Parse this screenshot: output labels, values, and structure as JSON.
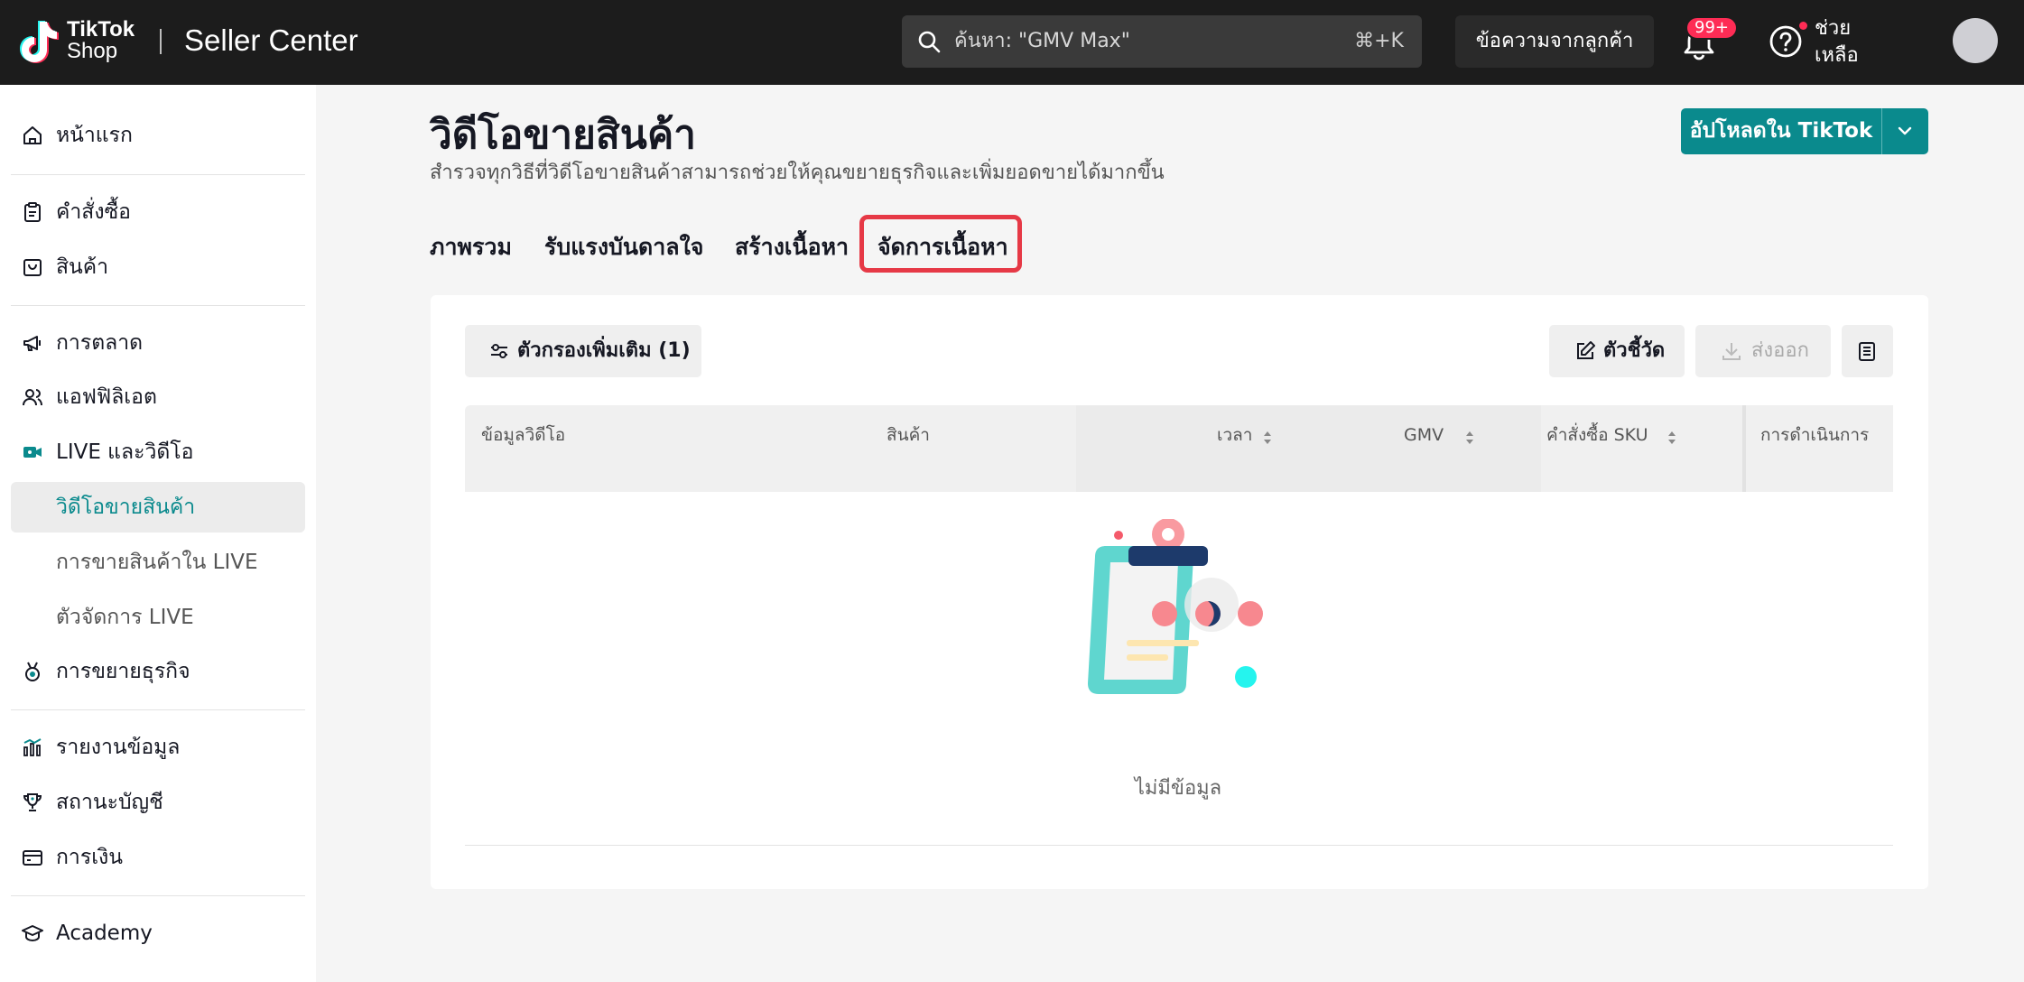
{
  "header": {
    "logo_tiktok": "TikTok",
    "logo_shop": "Shop",
    "title": "Seller Center",
    "search_placeholder": "ค้นหา: \"GMV Max\"",
    "search_shortcut": "⌘+K",
    "messages_button": "ข้อความจากลูกค้า",
    "notification_badge": "99+",
    "help_label": "ช่วยเหลือ"
  },
  "sidebar": {
    "items": [
      {
        "label": "หน้าแรก",
        "icon": "home-icon"
      },
      {
        "label": "คำสั่งซื้อ",
        "icon": "clipboard-icon"
      },
      {
        "label": "สินค้า",
        "icon": "bag-icon"
      },
      {
        "label": "การตลาด",
        "icon": "megaphone-icon"
      },
      {
        "label": "แอฟฟิลิเอต",
        "icon": "people-icon"
      },
      {
        "label": "LIVE และวิดีโอ",
        "icon": "video-camera-icon"
      },
      {
        "label": "วิดีโอขายสินค้า",
        "icon": ""
      },
      {
        "label": "การขายสินค้าใน LIVE",
        "icon": ""
      },
      {
        "label": "ตัวจัดการ LIVE",
        "icon": ""
      },
      {
        "label": "การขยายธุรกิจ",
        "icon": "medal-icon"
      },
      {
        "label": "รายงานข้อมูล",
        "icon": "bar-chart-icon"
      },
      {
        "label": "สถานะบัญชี",
        "icon": "trophy-icon"
      },
      {
        "label": "การเงิน",
        "icon": "wallet-icon"
      },
      {
        "label": "Academy",
        "icon": "graduation-cap-icon"
      }
    ]
  },
  "main": {
    "title": "วิดีโอขายสินค้า",
    "subtitle": "สำรวจทุกวิธีที่วิดีโอขายสินค้าสามารถช่วยให้คุณขยายธุรกิจและเพิ่มยอดขายได้มากขึ้น",
    "upload_button": "อัปโหลดใน TikTok",
    "tabs": [
      {
        "label": "ภาพรวม"
      },
      {
        "label": "รับแรงบันดาลใจ"
      },
      {
        "label": "สร้างเนื้อหา"
      },
      {
        "label": "จัดการเนื้อหา"
      }
    ],
    "filter_button": "ตัวกรองเพิ่มเติม (1)",
    "metrics_button": "ตัวชี้วัด",
    "export_button": "ส่งออก",
    "table": {
      "columns": [
        "ข้อมูลวิดีโอ",
        "สินค้า",
        "เวลา",
        "GMV",
        "คำสั่งซื้อ SKU",
        "การดำเนินการ"
      ]
    },
    "empty_text": "ไม่มีข้อมูล"
  },
  "colors": {
    "accent": "#0a8a8d",
    "highlight": "#e63946",
    "badge": "#fe2c55"
  }
}
